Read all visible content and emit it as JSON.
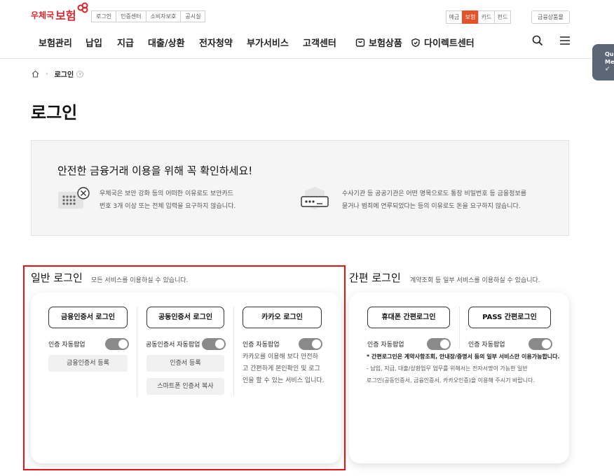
{
  "brand": {
    "small": "우체국",
    "big": "보험",
    "color": "#d9272e"
  },
  "utility_links": [
    "로그인",
    "인증센터",
    "소비자보호",
    "공시실"
  ],
  "category_tabs": [
    {
      "label": "예금",
      "active": false
    },
    {
      "label": "보험",
      "active": true
    },
    {
      "label": "카드",
      "active": false
    },
    {
      "label": "펀드",
      "active": false
    }
  ],
  "finance_products": "금융상품몰",
  "nav": [
    "보험관리",
    "납입",
    "지급",
    "대출/상환",
    "전자청약",
    "부가서비스",
    "고객센터",
    "보험상품",
    "다이렉트센터"
  ],
  "icons": {
    "search": "search-icon",
    "menu": "hamburger-menu-icon",
    "home": "home-icon"
  },
  "quick_menu": {
    "line1": "Qu",
    "line2": "Me"
  },
  "breadcrumb": {
    "current": "로그인"
  },
  "page_title": "로그인",
  "notice": {
    "heading": "안전한 금융거래 이용을 위해 꼭 확인하세요!",
    "items": [
      {
        "line1": "우체국은 보안 강화 등의 어떠한 이유로도 보안카드",
        "line2": "번호 3개 이상 또는 전체 입력을 요구하지 않습니다."
      },
      {
        "line1": "수사기관 등 공공기관은 어떤 명목으로도 통장 비밀번호 등 금융정보를",
        "line2": "묻거나 범죄에 연루되었다는 등의 이유로도 돈을 요구하지 않습니다."
      }
    ]
  },
  "general_login": {
    "title": "일반 로그인",
    "subtitle": "모든 서비스를 이용하실 수 있습니다.",
    "columns": [
      {
        "button": "금융인증서 로그인",
        "toggle_label": "인증 자동팝업",
        "actions": [
          "금융인증서 등록"
        ]
      },
      {
        "button": "공동인증서 로그인",
        "toggle_label": "공동인증서 자동팝업",
        "actions": [
          "인증서 등록",
          "스마트폰 인증서 복사"
        ]
      },
      {
        "button": "카카오 로그인",
        "toggle_label": "인증 자동팝업",
        "desc": [
          "카카오를 이용해 보다 안전하",
          "고 간편하게 본인확인 및 로그",
          "인을 할 수 있는 서비스 입니다."
        ]
      }
    ]
  },
  "simple_login": {
    "title": "간편 로그인",
    "subtitle": "계약조회 등 일부 서비스를 이용하실 수 있습니다.",
    "columns": [
      {
        "button": "휴대폰 간편로그인",
        "toggle_label": "인증 자동팝업"
      },
      {
        "button": "PASS 간편로그인",
        "toggle_label": "인증 자동팝업"
      }
    ],
    "note_bold": "* 간편로그인은 계약사항조회, 안내장/증명서 등의 일부 서비스만 이용가능합니다.",
    "note": [
      "- 납입, 지급, 대출/상환업무 업무를 위해서는 전자서명이 가능한 일반",
      "로그인(공동인증서, 금융인증서, 카카오인증)을 이용해 주시기 바랍니다."
    ]
  },
  "colors": {
    "accent": "#e2532c",
    "brand": "#d9272e",
    "highlight": "#e11111",
    "toggle": "#8a8a8a"
  }
}
